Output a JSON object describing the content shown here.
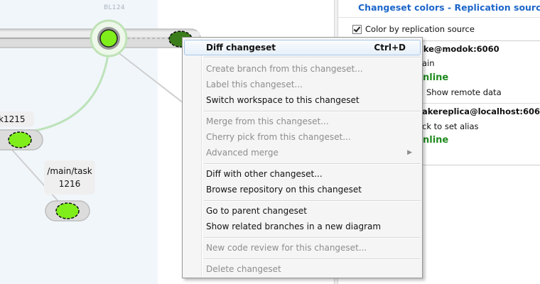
{
  "diagram": {
    "lane_label": "BL124",
    "branch_labels": {
      "task1215_partial": "k1215",
      "task1216_path": "/main/task",
      "task1216_number": "1216"
    }
  },
  "side_panel": {
    "title": "Changeset colors - Replication sources",
    "color_by_label": "Color by replication source",
    "color_by_checked": true,
    "sources": [
      {
        "server": "ake@modok:6060",
        "branch": "ain",
        "status": "nline",
        "option_label": "Show remote data"
      },
      {
        "server": "akereplica@localhost:6060",
        "alias_hint": "ck to set alias",
        "status": "nline"
      }
    ],
    "colors": {
      "title": "#1d66c9",
      "status_online": "#1e8a1e"
    }
  },
  "context_menu": {
    "items": [
      {
        "label": "Diff changeset",
        "shortcut": "Ctrl+D",
        "enabled": true,
        "bold": true,
        "highlighted": true
      },
      {
        "label": "Create branch from this changeset...",
        "enabled": false
      },
      {
        "label": "Label this changeset...",
        "enabled": false
      },
      {
        "label": "Switch workspace to this changeset",
        "enabled": true
      },
      {
        "label": "Merge from this changeset...",
        "enabled": false
      },
      {
        "label": "Cherry pick from this changeset...",
        "enabled": false
      },
      {
        "label": "Advanced merge",
        "enabled": false,
        "submenu": true
      },
      {
        "label": "Diff with other changeset...",
        "enabled": true
      },
      {
        "label": "Browse repository on this changeset",
        "enabled": true
      },
      {
        "label": "Go to parent changeset",
        "enabled": true
      },
      {
        "label": "Show related branches in a new diagram",
        "enabled": true
      },
      {
        "label": "New code review for this changeset...",
        "enabled": false
      },
      {
        "label": "Delete changeset",
        "enabled": false
      }
    ],
    "submenu_icon": "chevron-right-icon"
  }
}
